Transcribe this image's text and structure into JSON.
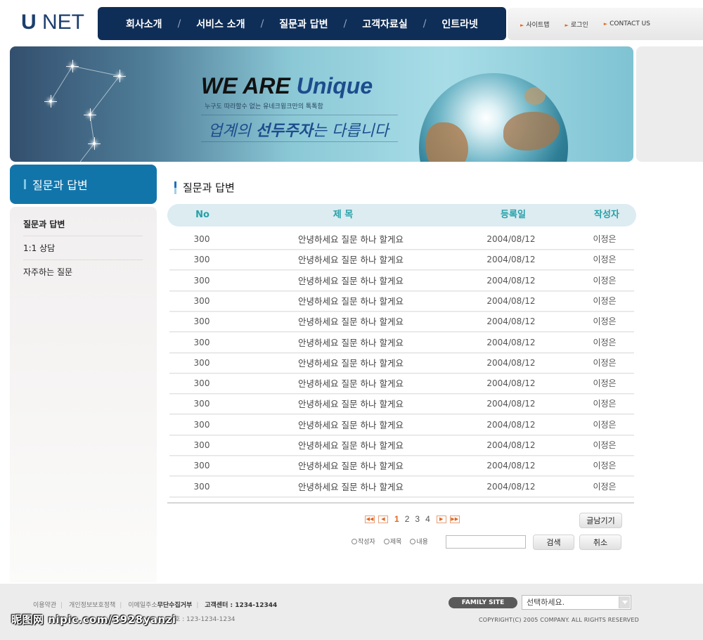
{
  "logo": {
    "strong": "U",
    "rest": " NET"
  },
  "gnb": [
    "회사소개",
    "서비스 소개",
    "질문과 답변",
    "고객자료실",
    "인트라넷"
  ],
  "gnb_separator": "/",
  "util": [
    "사이트맵",
    "로그인",
    "CONTACT US"
  ],
  "visual": {
    "headline_a": "WE ARE ",
    "headline_b": "Unique",
    "subline": "누구도 따라할수 없는 유네크윙크만의 톡톡함",
    "copy_a": "업계의 ",
    "copy_b": "선두주자",
    "copy_c": "는 다릅니다"
  },
  "sidebar": {
    "title": "질문과 답변",
    "items": [
      "질문과 답변",
      "1:1 상담",
      "자주하는 질문"
    ]
  },
  "content": {
    "title": "질문과 답변",
    "columns": [
      "No",
      "제 목",
      "등록일",
      "작성자"
    ],
    "rows": [
      {
        "no": "300",
        "subject": "안녕하세요 질문 하나 할게요",
        "date": "2004/08/12",
        "author": "이정은"
      },
      {
        "no": "300",
        "subject": "안녕하세요 질문 하나 할게요",
        "date": "2004/08/12",
        "author": "이정은"
      },
      {
        "no": "300",
        "subject": "안녕하세요 질문 하나 할게요",
        "date": "2004/08/12",
        "author": "이정은"
      },
      {
        "no": "300",
        "subject": "안녕하세요 질문 하나 할게요",
        "date": "2004/08/12",
        "author": "이정은"
      },
      {
        "no": "300",
        "subject": "안녕하세요 질문 하나 할게요",
        "date": "2004/08/12",
        "author": "이정은"
      },
      {
        "no": "300",
        "subject": "안녕하세요 질문 하나 할게요",
        "date": "2004/08/12",
        "author": "이정은"
      },
      {
        "no": "300",
        "subject": "안녕하세요 질문 하나 할게요",
        "date": "2004/08/12",
        "author": "이정은"
      },
      {
        "no": "300",
        "subject": "안녕하세요 질문 하나 할게요",
        "date": "2004/08/12",
        "author": "이정은"
      },
      {
        "no": "300",
        "subject": "안녕하세요 질문 하나 할게요",
        "date": "2004/08/12",
        "author": "이정은"
      },
      {
        "no": "300",
        "subject": "안녕하세요 질문 하나 할게요",
        "date": "2004/08/12",
        "author": "이정은"
      },
      {
        "no": "300",
        "subject": "안녕하세요 질문 하나 할게요",
        "date": "2004/08/12",
        "author": "이정은"
      },
      {
        "no": "300",
        "subject": "안녕하세요 질문 하나 할게요",
        "date": "2004/08/12",
        "author": "이정은"
      },
      {
        "no": "300",
        "subject": "안녕하세요 질문 하나 할게요",
        "date": "2004/08/12",
        "author": "이정은"
      }
    ],
    "pages": [
      "1",
      "2",
      "3",
      "4"
    ],
    "current_page": "1",
    "write_button": "글남기기",
    "search_options": [
      "작성자",
      "제목",
      "내용"
    ],
    "search_value": "",
    "search_button": "검색",
    "cancel_button": "취소"
  },
  "footer": {
    "links": [
      "이용약관",
      "개인정보보호정책",
      "이메일주소"
    ],
    "links_bold": "무단수집거부",
    "center": "고객센터 : 1234-12344",
    "address_tail": "호 : 123-1234-1234",
    "family_label": "FAMILY SITE",
    "family_select": "선택하세요.",
    "copyright": "COPYRIGHT(C) 2005 COMPANY. ALL RIGHTS RESERVED",
    "watermark": "昵图网 nipic.com/3928yanzi"
  },
  "colors": {
    "navy": "#0f2e57",
    "accent_blue": "#1275aa",
    "table_head_text": "#26a0a8",
    "paging_orange": "#e2661d"
  }
}
